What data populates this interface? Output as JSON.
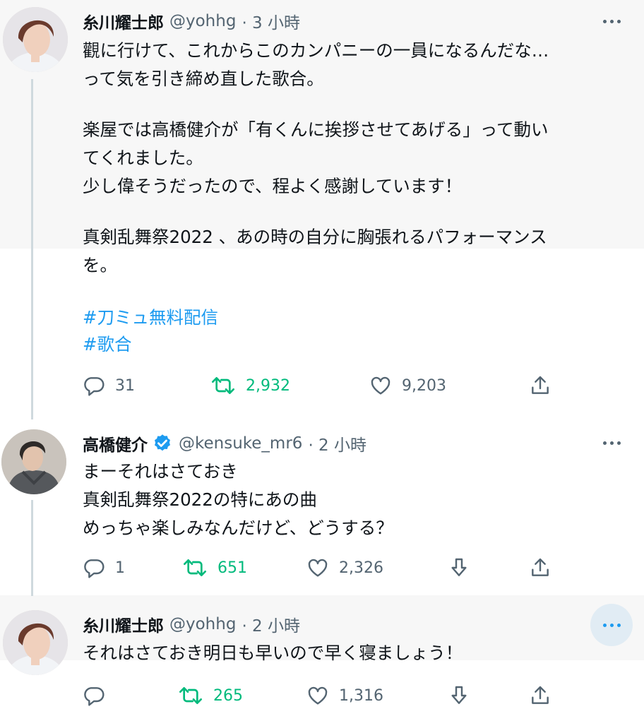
{
  "tweets": [
    {
      "name": "糸川耀士郎",
      "handle": "@yohhg",
      "time": "· 3 小時",
      "lines": [
        "觀に行けて、これからこのカンパニーの一員になるんだな…",
        "って気を引き締め直した歌合。",
        "",
        "楽屋では高橋健介が「有くんに挨拶させてあげる」って動い",
        "てくれました。",
        "少し偉そうだったので、程よく感謝しています！",
        "",
        "真剣乱舞祭2022 、あの時の自分に胸張れるパフォーマンス",
        "を。"
      ],
      "hashtags": [
        "#刀ミュ無料配信",
        "#歌合"
      ],
      "replies": "31",
      "retweets": "2,932",
      "likes": "9,203"
    },
    {
      "name": "高橋健介",
      "handle": "@kensuke_mr6",
      "time": "· 2 小時",
      "verified": true,
      "lines": [
        "まーそれはさておき",
        "真剣乱舞祭2022の特にあの曲",
        "めっちゃ楽しみなんだけど、どうする？"
      ],
      "replies": "1",
      "retweets": "651",
      "likes": "2,326"
    },
    {
      "name": "糸川耀士郎",
      "handle": "@yohhg",
      "time": "· 2 小時",
      "lines": [
        "それはさておき明日も早いので早く寝ましょう！"
      ],
      "replies": "",
      "retweets": "265",
      "likes": "1,316"
    }
  ],
  "icons": [
    "avatar",
    "more-icon",
    "reply-icon",
    "retweet-icon",
    "like-icon",
    "bookmark-icon",
    "share-icon",
    "verified-icon"
  ],
  "colors": {
    "accent": "#1d9bf0",
    "retweet": "#00ba7c",
    "muted": "#536471",
    "thread_line": "#cfd9de"
  }
}
